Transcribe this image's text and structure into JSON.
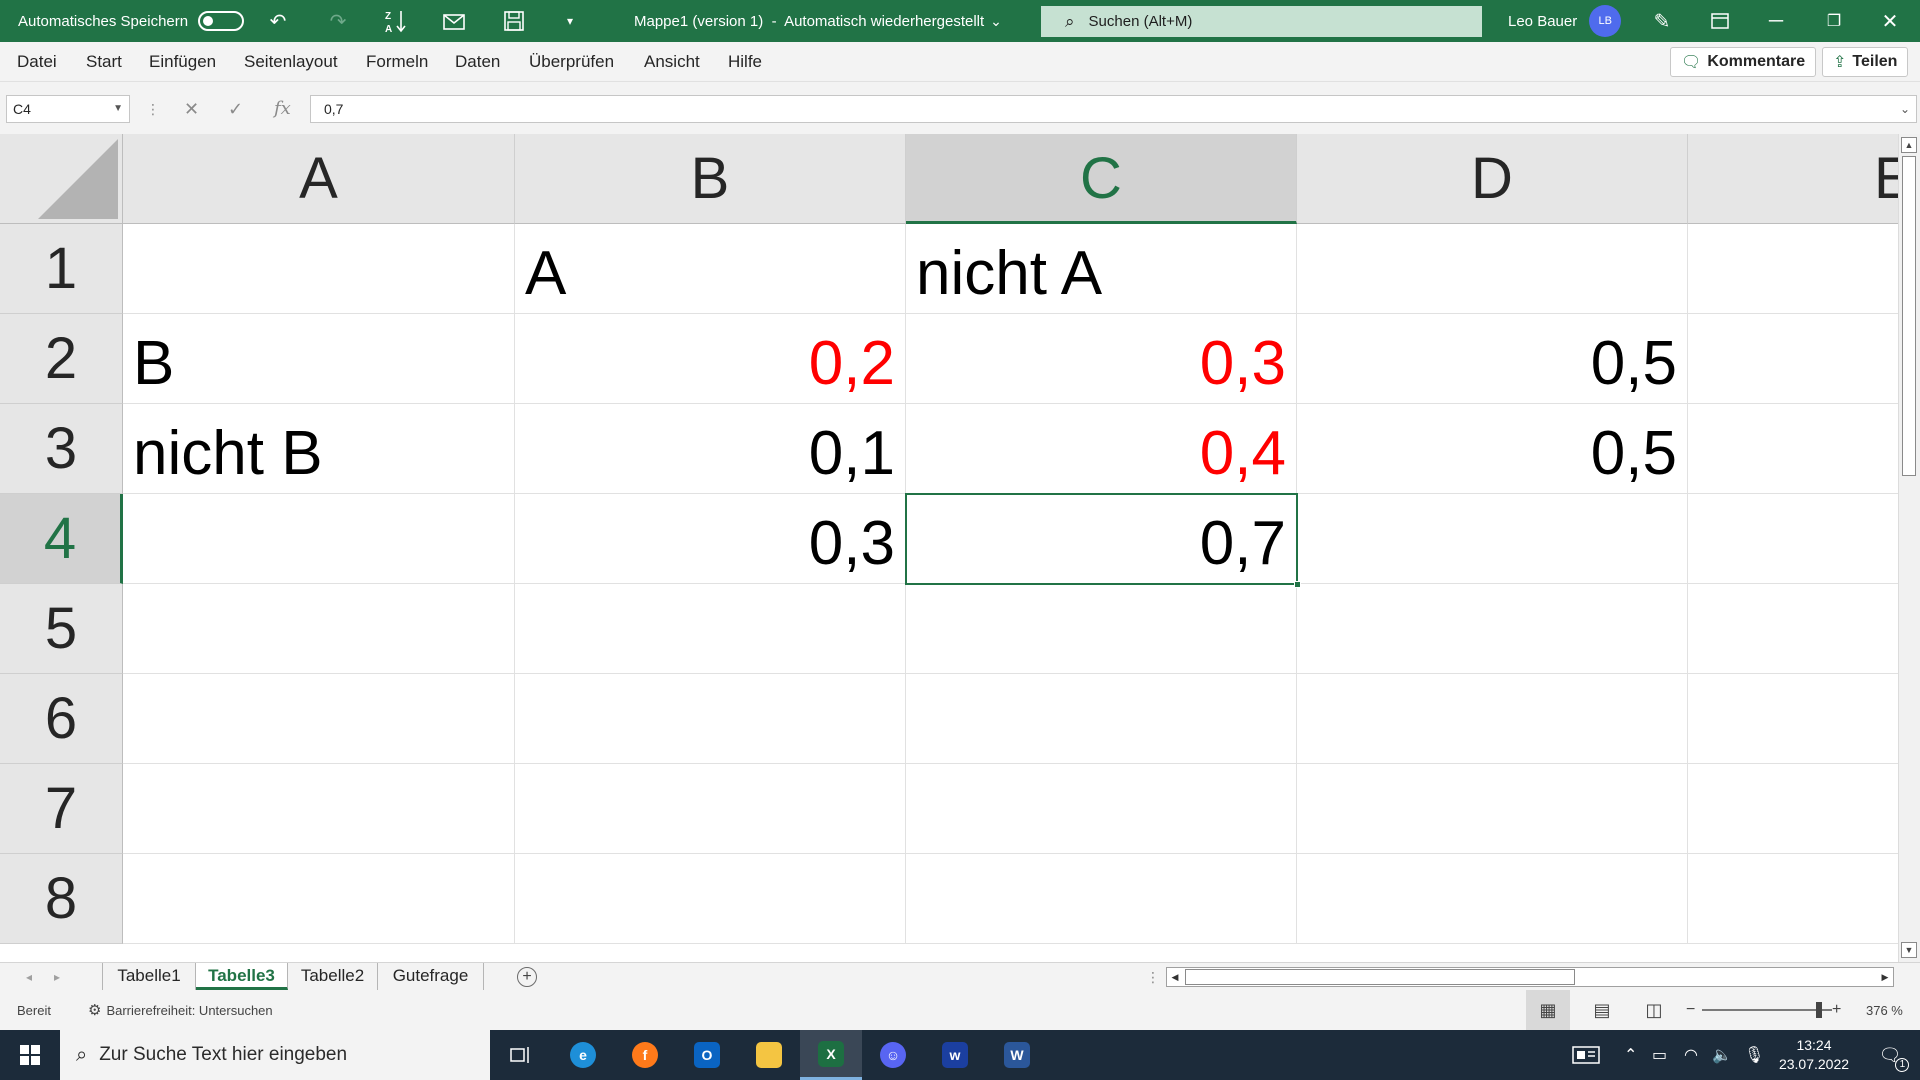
{
  "titlebar": {
    "autosave_label": "Automatisches Speichern",
    "window_title": "Mappe1 (version 1)  -  Automatisch wiederhergestellt",
    "title_chevron": "⌄",
    "search_placeholder": "Suchen (Alt+M)",
    "user_name": "Leo Bauer",
    "user_initials": "LB"
  },
  "menu": {
    "items": [
      "Datei",
      "Start",
      "Einfügen",
      "Seitenlayout",
      "Formeln",
      "Daten",
      "Überprüfen",
      "Ansicht",
      "Hilfe"
    ],
    "comments_label": "Kommentare",
    "share_label": "Teilen"
  },
  "formula_bar": {
    "name_box": "C4",
    "formula": "0,7"
  },
  "grid": {
    "columns": [
      "A",
      "B",
      "C",
      "D",
      "E"
    ],
    "rows": [
      "1",
      "2",
      "3",
      "4",
      "5",
      "6",
      "7",
      "8"
    ],
    "cells": {
      "B1": "A",
      "C1": "nicht A",
      "A2": "B",
      "B2": "0,2",
      "C2": "0,3",
      "D2": "0,5",
      "A3": "nicht B",
      "B3": "0,1",
      "C3": "0,4",
      "D3": "0,5",
      "B4": "0,3",
      "C4": "0,7"
    },
    "selected_cell": "C4",
    "highlight_color": "#ff0000"
  },
  "sheets": {
    "tabs": [
      "Tabelle1",
      "Tabelle3",
      "Tabelle2",
      "Gutefrage"
    ],
    "active": "Tabelle3"
  },
  "status": {
    "ready": "Bereit",
    "accessibility": "Barrierefreiheit: Untersuchen",
    "zoom": "376 %"
  },
  "taskbar": {
    "search_placeholder": "Zur Suche Text hier eingeben",
    "time": "13:24",
    "date": "23.07.2022",
    "notification_count": "1"
  }
}
